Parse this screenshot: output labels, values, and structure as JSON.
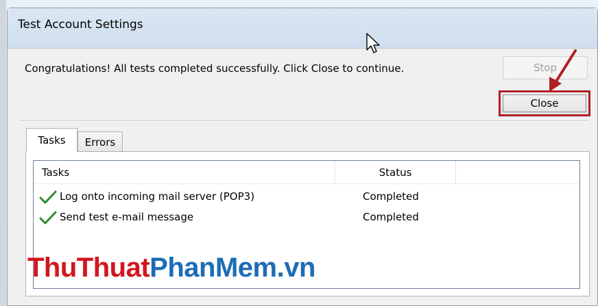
{
  "window": {
    "title": "Test Account Settings",
    "message": "Congratulations! All tests completed successfully. Click Close to continue."
  },
  "buttons": {
    "stop_label": "Stop",
    "close_label": "Close"
  },
  "tabs": [
    {
      "label": "Tasks",
      "selected": true
    },
    {
      "label": "Errors",
      "selected": false
    }
  ],
  "table": {
    "headers": [
      "Tasks",
      "Status"
    ],
    "rows": [
      {
        "task": "Log onto incoming mail server (POP3)",
        "status": "Completed",
        "icon": "check-icon"
      },
      {
        "task": "Send test e-mail message",
        "status": "Completed",
        "icon": "check-icon"
      }
    ]
  },
  "watermark": {
    "part1": "ThuThuat",
    "part2": "PhanMem.vn"
  },
  "colors": {
    "highlight": "#b01f24",
    "check": "#2e8b2e",
    "watermark_red": "#d3161d",
    "watermark_blue": "#1c6db5"
  }
}
